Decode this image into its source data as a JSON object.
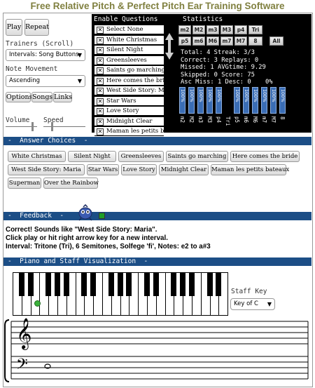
{
  "app": {
    "title": "Free Relative Pitch & Perfect Pitch Ear Training Software"
  },
  "controls": {
    "play_label": "Play",
    "repeat_label": "Repeat",
    "trainers_label": "Trainers (Scroll)",
    "trainers_value": "Intervals: Song Buttons",
    "note_movement_label": "Note Movement",
    "note_movement_value": "Ascending",
    "options_label": "Options",
    "songs_label": "Songs",
    "links_label": "Links",
    "volume_label": "Volume",
    "speed_label": "Speed",
    "volume_level": 0.85,
    "speed_level": 0.2
  },
  "enable_questions": {
    "header": "Enable Questions",
    "items": [
      {
        "label": "Select None",
        "checked": true
      },
      {
        "label": "White Christmas",
        "checked": true
      },
      {
        "label": "Silent Night",
        "checked": true
      },
      {
        "label": "Greensleeves",
        "checked": true
      },
      {
        "label": "Saints go marching",
        "checked": true
      },
      {
        "label": "Here comes the bri.",
        "checked": true
      },
      {
        "label": "West Side Story: M.",
        "checked": true
      },
      {
        "label": "Star Wars",
        "checked": true
      },
      {
        "label": "Love Story",
        "checked": true
      },
      {
        "label": "Midnight Clear",
        "checked": true
      },
      {
        "label": "Maman les petits b.",
        "checked": true
      }
    ]
  },
  "statistics": {
    "header": "Statistics",
    "interval_buttons_row1": [
      "m2",
      "M2",
      "m3",
      "M3",
      "p4",
      "Tri"
    ],
    "interval_buttons_row2": [
      "p5",
      "m6",
      "M6",
      "m7",
      "M7",
      "8"
    ],
    "all_label": "All",
    "lines": [
      "Total:     4   Streak: 3/3",
      "Correct:   3   Replays: 0",
      "Missed:    1   AVGtime: 9.29",
      "Skipped:   0   Score:   75",
      "Asc Miss:  1   Desc:    0"
    ],
    "pct_label": "0%",
    "bars": [
      {
        "pct": "100%",
        "label": "m2"
      },
      {
        "pct": "100%",
        "label": "M2"
      },
      {
        "pct": "100%",
        "label": "m3"
      },
      {
        "pct": "100%",
        "label": "M3"
      },
      {
        "pct": "100%",
        "label": "p4"
      },
      {
        "pct": "0%",
        "label": "Tri"
      },
      {
        "pct": "100%",
        "label": "p5"
      },
      {
        "pct": "100%",
        "label": "m6"
      },
      {
        "pct": "100%",
        "label": "M6"
      },
      {
        "pct": "100%",
        "label": "m7"
      },
      {
        "pct": "100%",
        "label": "M7"
      },
      {
        "pct": "100%",
        "label": "8"
      }
    ]
  },
  "answer_choices": {
    "header": "Answer Choices",
    "buttons": [
      "White Christmas",
      "Silent Night",
      "Greensleeves",
      "Saints go marching",
      "Here comes the bride",
      "West Side Story: Maria",
      "Star Wars",
      "Love Story",
      "Midnight Clear",
      "Maman les petits bateaux",
      "Superman",
      "Over the Rainbow"
    ]
  },
  "feedback": {
    "header": "Feedback",
    "line1": "Correct! Sounds like \"West Side Story: Maria\".",
    "line2": "Click play or hit right arrow key for a new interval.",
    "line3": "Interval:  Tritone (Tri), 6 Semitones, Solfege 'fi', Notes:     e2 to a#3",
    "indicator_color": "#1e9e28"
  },
  "piano": {
    "header": "Piano and Staff Visualization",
    "staff_key_label": "Staff Key",
    "staff_key_value": "Key of C",
    "highlight_color": "#3bb03b"
  },
  "colors": {
    "accent": "#1c4e86",
    "title": "#808040"
  }
}
